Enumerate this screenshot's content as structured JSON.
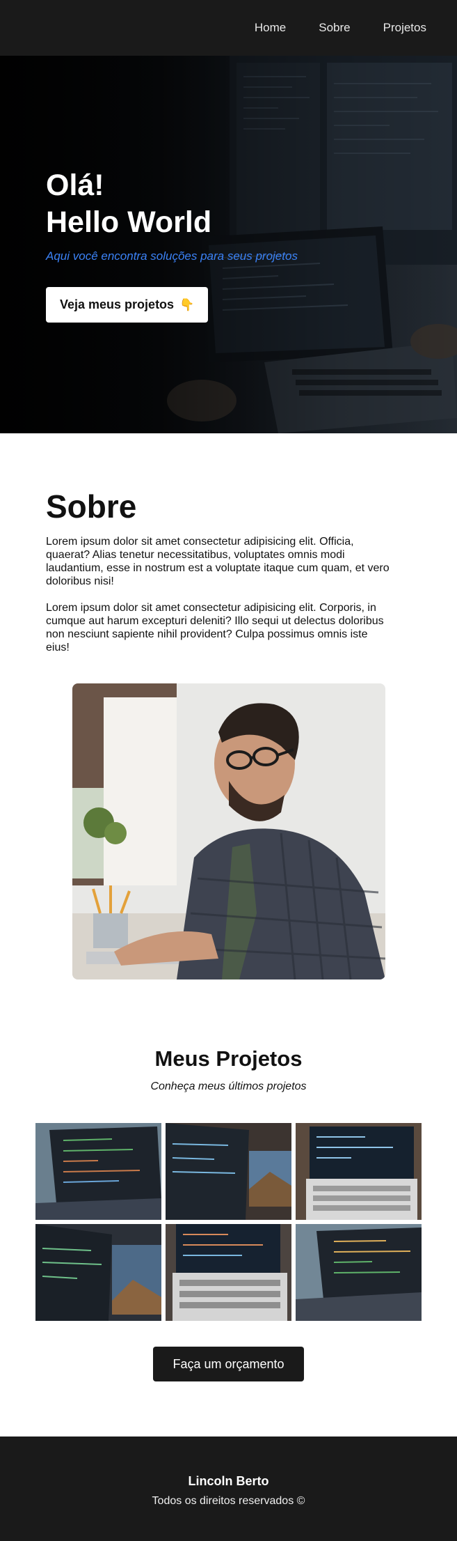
{
  "nav": {
    "items": [
      {
        "label": "Home"
      },
      {
        "label": "Sobre"
      },
      {
        "label": "Projetos"
      }
    ]
  },
  "hero": {
    "title_line1": "Olá!",
    "title_line2": "Hello World",
    "subtitle": "Aqui você encontra soluções para seus projetos",
    "button_label": "Veja meus projetos",
    "button_icon": "pointing-down-hand-icon"
  },
  "about": {
    "title": "Sobre",
    "paragraphs": [
      "Lorem ipsum dolor sit amet consectetur adipisicing elit. Officia, quaerat? Alias tenetur necessitatibus, voluptates omnis modi laudantium, esse in nostrum est a voluptate itaque cum quam, et vero doloribus nisi!",
      "Lorem ipsum dolor sit amet consectetur adipisicing elit. Corporis, in cumque aut harum excepturi deleniti? Illo sequi ut delectus doloribus non nesciunt sapiente nihil provident? Culpa possimus omnis iste eius!"
    ]
  },
  "projects": {
    "title": "Meus Projetos",
    "subtitle": "Conheça meus últimos projetos",
    "cta_label": "Faça um orçamento"
  },
  "footer": {
    "name": "Lincoln Berto",
    "copyright": "Todos os direitos reservados ©"
  },
  "colors": {
    "nav_bg": "#1a1a1a",
    "accent_blue": "#3b82f6",
    "footer_bg": "#1a1a1a"
  }
}
